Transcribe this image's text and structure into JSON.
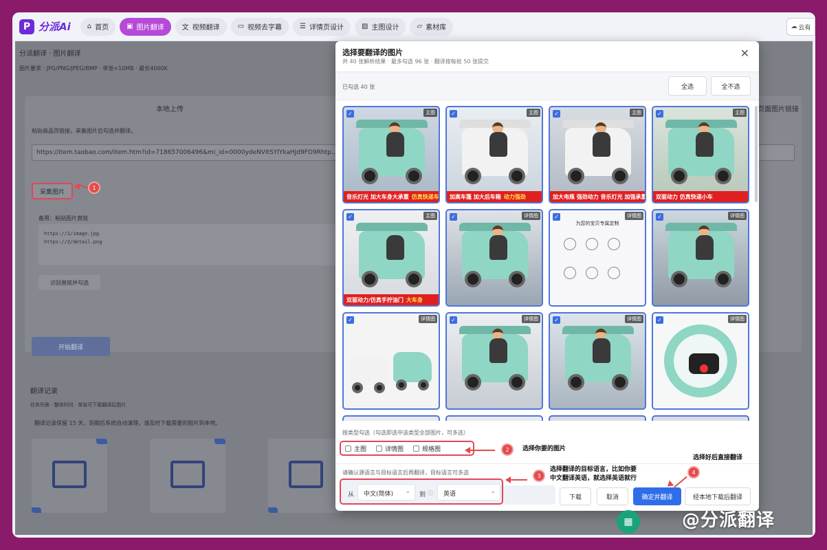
{
  "app": {
    "logo_mark": "P",
    "logo_text": "分派Ai"
  },
  "nav": {
    "tabs": [
      {
        "icon": "home-icon",
        "label": "首页"
      },
      {
        "icon": "image-icon",
        "label": "图片翻译"
      },
      {
        "icon": "translate-icon",
        "label": "视频翻译"
      },
      {
        "icon": "subtitle-icon",
        "label": "视频去字幕"
      },
      {
        "icon": "detail-icon",
        "label": "详情页设计"
      },
      {
        "icon": "picture-icon",
        "label": "主图设计"
      },
      {
        "icon": "folder-icon",
        "label": "素材库"
      }
    ],
    "active_index": 1,
    "cloud_label": "云有"
  },
  "background": {
    "title": "分派翻译 · 图片翻译",
    "requirements": "图片要求 · JPG/PNG/JPEG/BMP · 单张<10MB · 最长4000K",
    "tab_upload": "本地上传",
    "tab_link": "页面图片链接",
    "hint": "粘贴商品页链接，采集图片后勾选并翻译。",
    "url": "https://item.taobao.com/item.htm?id=718657006496&mi_id=0000ydeNVltSYlYkaHJd9FO9Rhtp...a21bo.jianhua%2",
    "collect_btn": "采集图片",
    "backup_label": "备用：粘贴图片直链",
    "textarea_lines": [
      "https://1/image.jpg",
      "https://2/detail.png"
    ],
    "recognize_btn": "识别直链并勾选",
    "start_btn": "开始翻译",
    "history_title": "翻译记录",
    "history_sub": "任务列表 · 整体时间 · 单张可下载翻译后图片",
    "warning": "翻译记录保留 15 天，到期后系统自动清理，请及时下载需要的图片到本地。"
  },
  "modal": {
    "title": "选择要翻译的图片",
    "subtitle": "共 40 张解析结果 · 最多勾选 96 张 · 翻译按每批 50 张提交",
    "selected_count": "已勾选 40 张",
    "select_all": "全选",
    "select_none": "全不选",
    "tiles": [
      {
        "badge": "主图",
        "caption": "音乐灯光 加大车身大承重",
        "caption_hl": "仿真快递车"
      },
      {
        "badge": "主图",
        "caption": "加高车篷 加大后车箱",
        "caption_hl": "动力强劲"
      },
      {
        "badge": "主图",
        "caption": "加大电瓶 强劲动力 音乐灯光 加强承重",
        "caption_hl": ""
      },
      {
        "badge": "主图",
        "caption": "双驱动力 仿真快递小车",
        "caption_hl": ""
      },
      {
        "badge": "主图",
        "caption": "双驱动力/仿真手拧油门",
        "caption_hl": "大车身"
      },
      {
        "badge": "详情图",
        "caption": "",
        "caption_hl": ""
      },
      {
        "badge": "详情图",
        "caption": "",
        "caption_hl": ""
      },
      {
        "badge": "详情图",
        "caption": "",
        "caption_hl": ""
      },
      {
        "badge": "详情图",
        "caption": "",
        "caption_hl": ""
      },
      {
        "badge": "详情图",
        "caption": "",
        "caption_hl": ""
      },
      {
        "badge": "详情图",
        "caption": "",
        "caption_hl": ""
      },
      {
        "badge": "详情图",
        "caption": "",
        "caption_hl": ""
      }
    ],
    "sheet_title": "为您的宝贝专属定制",
    "filter_title": "按类型勾选（勾选即选中该类型全部图片，可多选）",
    "filters": [
      "主图",
      "详情图",
      "规格图"
    ],
    "lang_title": "请确认源语言与目标语言后再翻译，目标语言可多选",
    "from_label": "从",
    "source_lang": "中文(简体)",
    "to_label": "到",
    "target_lang": "英语",
    "buttons": {
      "download": "下载",
      "cancel": "取消",
      "confirm": "确定并翻译",
      "local": "经本地下载后翻译"
    }
  },
  "annotations": {
    "n1": "1",
    "n2": "2",
    "n3": "3",
    "n4": "4",
    "a2": "选择你要的图片",
    "a3_line1": "选择翻译的目标语言，比如你要",
    "a3_line2": "中文翻译英语，就选择英语就行",
    "a4": "选择好后直接翻译"
  },
  "watermark": "@分派翻译",
  "colors": {
    "accent": "#2f6ee8",
    "active_tab": "#b549d8",
    "highlight": "#e0475a"
  }
}
